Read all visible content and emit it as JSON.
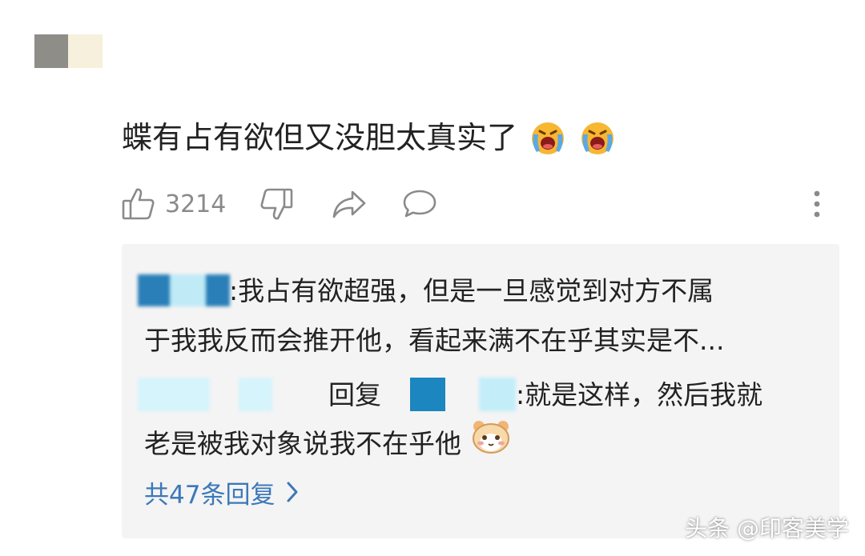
{
  "comment": {
    "text": "蝶有占有欲但又没胆太真实了",
    "emojis": [
      "crying-face-icon",
      "crying-face-icon"
    ],
    "likes": "3214"
  },
  "reply1": {
    "sep": ":",
    "line1": "我占有欲超强，但是一旦感觉到对方不属",
    "line2": "于我我反而会推开他，看起来满不在乎其实是不..."
  },
  "reply2": {
    "reply_word": "回复",
    "line1": ":就是这样，然后我就",
    "line2": "老是被我对象说我不在乎他",
    "emoji": "hamster-face-icon"
  },
  "more_replies": "共47条回复",
  "watermark": "头条 @印客美学",
  "colors": {
    "link": "#3d78b8",
    "reply_bg": "#f4f4f4",
    "icon_gray": "#8a8a8a"
  }
}
